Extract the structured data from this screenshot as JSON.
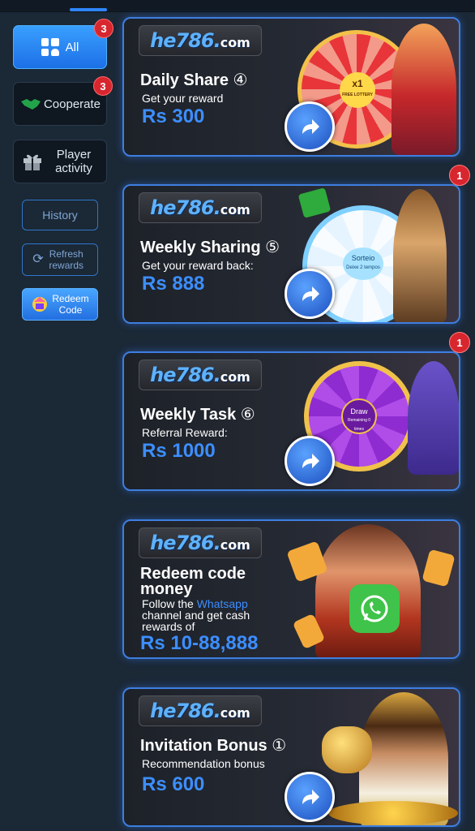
{
  "sidebar": {
    "all_label": "All",
    "all_badge": "3",
    "cooperate_label": "Cooperate",
    "cooperate_badge": "3",
    "player_activity_label": "Player activity",
    "history_label": "History",
    "refresh_label": "Refresh rewards",
    "redeem_label": "Redeem Code"
  },
  "logo": {
    "main": "he786.",
    "suffix": "com"
  },
  "cards": [
    {
      "title": "Daily Share",
      "step": "④",
      "subtitle": "Get your reward",
      "amount": "Rs 300"
    },
    {
      "title": "Weekly Sharing",
      "step": "⑤",
      "subtitle": "Get your reward back:",
      "amount": "Rs 888",
      "badge": "1"
    },
    {
      "title": "Weekly Task",
      "step": "⑥",
      "subtitle": "Referral Reward:",
      "amount": "Rs 1000",
      "badge": "1"
    },
    {
      "title": "Redeem code money",
      "subtitle_pre": "Follow the",
      "subtitle_link": "Whatsapp",
      "subtitle_post": "channel and get cash rewards of",
      "amount": "Rs 10-88,888"
    },
    {
      "title": "Invitation Bonus",
      "step": "①",
      "subtitle": "Recommendation bonus",
      "amount": "Rs 600"
    }
  ],
  "wheels": {
    "daily_center": "x1",
    "daily_center_sub": "FREE LOTTERY",
    "weekly_center": "Sorteio",
    "weekly_center_sub": "Deixe 2 tempos",
    "task_center": "Draw",
    "task_center_sub": "Remaining 0 times"
  },
  "colors": {
    "accent": "#3c8eff",
    "badge": "#d8262f",
    "background": "#1b2836"
  }
}
